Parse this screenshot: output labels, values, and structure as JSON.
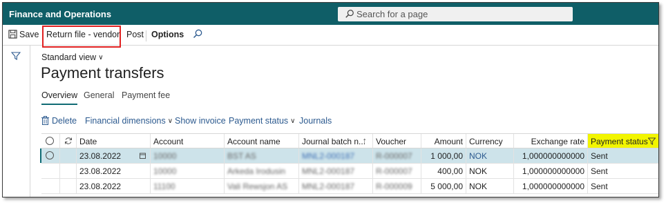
{
  "app": {
    "title": "Finance and Operations"
  },
  "search": {
    "placeholder": "Search for a page"
  },
  "actionpane": {
    "save_label": "Save",
    "return_file_label": "Return file - vendor",
    "post_label": "Post",
    "options_label": "Options"
  },
  "view": {
    "label": "Standard view"
  },
  "page": {
    "title": "Payment transfers"
  },
  "tabs": [
    {
      "label": "Overview",
      "active": true
    },
    {
      "label": "General",
      "active": false
    },
    {
      "label": "Payment fee",
      "active": false
    }
  ],
  "grid_toolbar": {
    "delete_label": "Delete",
    "financial_dimensions_label": "Financial dimensions",
    "show_invoice_label": "Show invoice",
    "payment_status_label": "Payment status",
    "journals_label": "Journals"
  },
  "grid": {
    "columns": [
      "Date",
      "Account",
      "Account name",
      "Journal batch n...",
      "Voucher",
      "Amount",
      "Currency",
      "Exchange rate",
      "Payment status"
    ],
    "rows": [
      {
        "date": "23.08.2022",
        "account": "10000",
        "account_name": "BST AS",
        "journal": "MNL2-000187",
        "voucher": "R-000007",
        "amount": "1 000,00",
        "currency": "NOK",
        "exchange_rate": "1,000000000000",
        "payment_status": "Sent",
        "selected": true
      },
      {
        "date": "23.08.2022",
        "account": "10000",
        "account_name": "Arkeda Irodusin",
        "journal": "MNL2-000187",
        "voucher": "R-000007",
        "amount": "400,00",
        "currency": "NOK",
        "exchange_rate": "1,000000000000",
        "payment_status": "Sent",
        "selected": false
      },
      {
        "date": "23.08.2022",
        "account": "11100",
        "account_name": "Vali Rewsjon AS",
        "journal": "MNL2-000187",
        "voucher": "R-000009",
        "amount": "5 000,00",
        "currency": "NOK",
        "exchange_rate": "1,000000000000",
        "payment_status": "Sent",
        "selected": false
      }
    ]
  },
  "colors": {
    "topbar": "#0f5e67",
    "highlight_border": "#e02020",
    "payment_status_highlight": "#f2f500",
    "selected_row": "#cde3ea",
    "link": "#2c5a8f"
  }
}
